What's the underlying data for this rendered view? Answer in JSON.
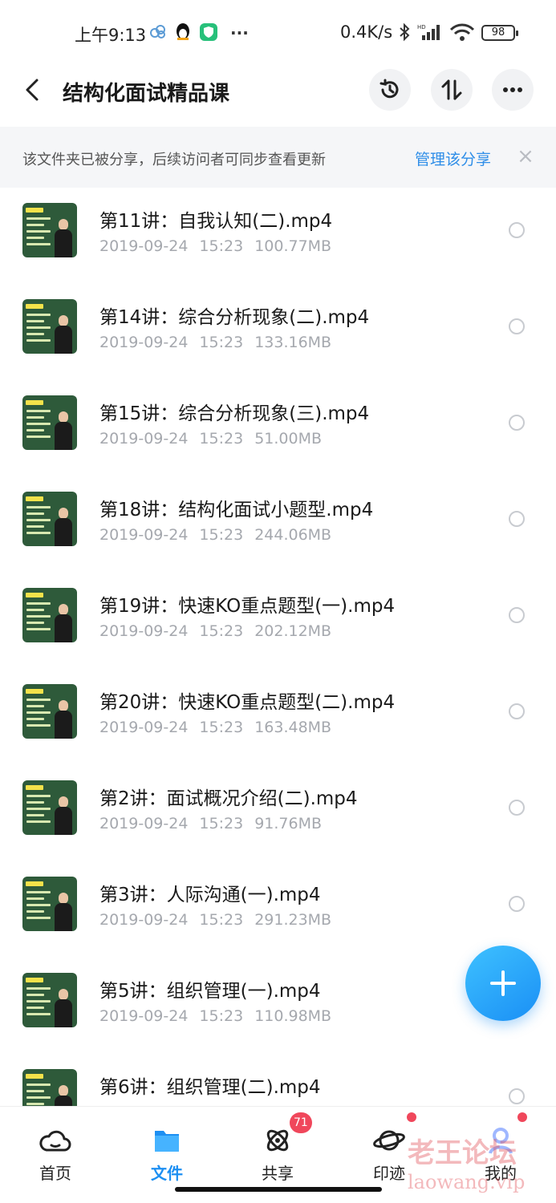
{
  "status_bar": {
    "time": "上午9:13",
    "more": "···",
    "net_speed": "0.4K/s",
    "battery": "98",
    "icons": [
      "cloud-icon",
      "penguin-icon",
      "shield-icon",
      "bluetooth-icon",
      "hd-signal-icon",
      "wifi-icon",
      "battery-icon"
    ]
  },
  "header": {
    "title": "结构化面试精品课",
    "buttons": [
      "history-icon",
      "sort-icon",
      "more-icon"
    ]
  },
  "notice": {
    "text": "该文件夹已被分享，后续访问者可同步查看更新",
    "link": "管理该分享",
    "close": "×"
  },
  "files": [
    {
      "name": "第11讲：自我认知(二).mp4",
      "date": "2019-09-24",
      "time": "15:23",
      "size": "100.77MB"
    },
    {
      "name": "第14讲：综合分析现象(二).mp4",
      "date": "2019-09-24",
      "time": "15:23",
      "size": "133.16MB"
    },
    {
      "name": "第15讲：综合分析现象(三).mp4",
      "date": "2019-09-24",
      "time": "15:23",
      "size": "51.00MB"
    },
    {
      "name": "第18讲：结构化面试小题型.mp4",
      "date": "2019-09-24",
      "time": "15:23",
      "size": "244.06MB"
    },
    {
      "name": "第19讲：快速KO重点题型(一).mp4",
      "date": "2019-09-24",
      "time": "15:23",
      "size": "202.12MB"
    },
    {
      "name": "第20讲：快速KO重点题型(二).mp4",
      "date": "2019-09-24",
      "time": "15:23",
      "size": "163.48MB"
    },
    {
      "name": "第2讲：面试概况介绍(二).mp4",
      "date": "2019-09-24",
      "time": "15:23",
      "size": "91.76MB"
    },
    {
      "name": "第3讲：人际沟通(一).mp4",
      "date": "2019-09-24",
      "time": "15:23",
      "size": "291.23MB"
    },
    {
      "name": "第5讲：组织管理(一).mp4",
      "date": "2019-09-24",
      "time": "15:23",
      "size": "110.98MB"
    },
    {
      "name": "第6讲：组织管理(二).mp4",
      "date": "",
      "time": "",
      "size": ""
    }
  ],
  "bottom_nav": {
    "tabs": [
      {
        "label": "首页",
        "icon": "cloud-icon",
        "active": false
      },
      {
        "label": "文件",
        "icon": "folder-icon",
        "active": true
      },
      {
        "label": "共享",
        "icon": "atom-icon",
        "active": false
      },
      {
        "label": "印迹",
        "icon": "planet-icon",
        "active": false
      },
      {
        "label": "我的",
        "icon": "profile-icon",
        "active": false
      }
    ],
    "share_badge": "71"
  },
  "watermark": {
    "cn": "老王论坛",
    "en": "laowang.vip"
  },
  "colors": {
    "accent": "#1d8ff2",
    "badge": "#f0475b",
    "thumb_bg": "#2e5a3a"
  }
}
